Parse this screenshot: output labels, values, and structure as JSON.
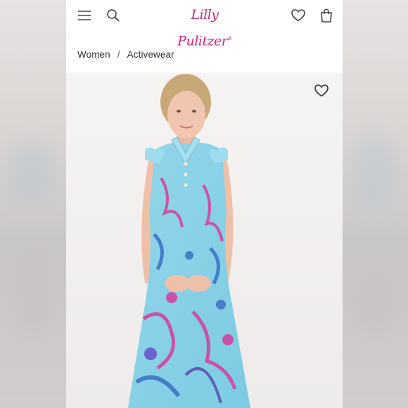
{
  "header": {
    "logo_text": "Lilly Pulitzer",
    "logo_color": "#d1287f",
    "icons": [
      "menu-icon",
      "search-icon",
      "heart-icon",
      "shopping-bag-icon"
    ]
  },
  "breadcrumb": {
    "items": [
      "Women",
      "Activewear"
    ],
    "separator": "/"
  },
  "product": {
    "image_alt": "Model wearing sleeveless ruffle polo dress in blue and pink tropical print",
    "favorite_icon": "heart-outline-icon",
    "print_colors": [
      "#8fd3e8",
      "#d63d9c",
      "#3a6fc4",
      "#6ec9e0"
    ]
  }
}
